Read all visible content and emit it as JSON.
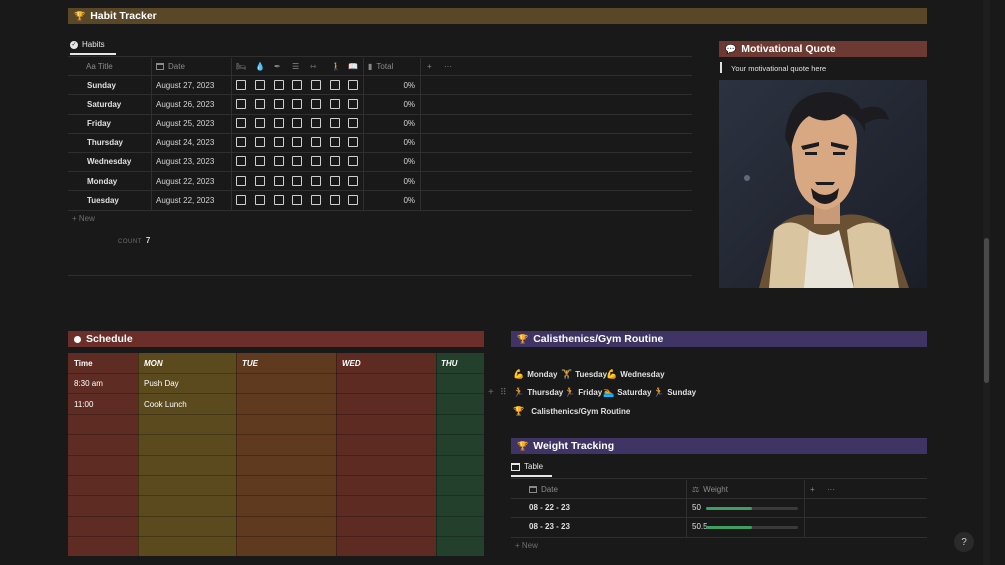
{
  "habit_tracker": {
    "banner_icon": "trophy-icon",
    "title": "Habit Tracker",
    "view_tab": "Habits",
    "columns": {
      "title": "Aa Title",
      "date": "Date",
      "habit_icons": [
        "bed-icon",
        "water-drop-icon",
        "pen-icon",
        "checklist-icon",
        "dumbbell-icon",
        "walking-icon",
        "book-icon"
      ],
      "total": "Total"
    },
    "rows": [
      {
        "title": "Sunday",
        "date": "August 27, 2023",
        "total": "0%"
      },
      {
        "title": "Saturday",
        "date": "August 26, 2023",
        "total": "0%"
      },
      {
        "title": "Friday",
        "date": "August 25, 2023",
        "total": "0%"
      },
      {
        "title": "Thursday",
        "date": "August 24, 2023",
        "total": "0%"
      },
      {
        "title": "Wednesday",
        "date": "August 23, 2023",
        "total": "0%"
      },
      {
        "title": "Monday",
        "date": "August 22, 2023",
        "total": "0%"
      },
      {
        "title": "Tuesday",
        "date": "August 22, 2023",
        "total": "0%"
      }
    ],
    "new_label": "New",
    "count_label": "COUNT",
    "count_value": "7"
  },
  "quote": {
    "title": "Motivational Quote",
    "text": "Your motivational quote here"
  },
  "schedule": {
    "title": "Schedule",
    "headers": [
      "Time",
      "MON",
      "TUE",
      "WED",
      "THU"
    ],
    "rows": [
      {
        "time": "8:30 am",
        "mon": "Push Day"
      },
      {
        "time": "11:00",
        "mon": "Cook Lunch"
      }
    ]
  },
  "calisthenics": {
    "title": "Calisthenics/Gym Routine",
    "days": [
      "Monday",
      "Tuesday",
      "Wednesday",
      "Thursday",
      "Friday",
      "Saturday",
      "Sunday"
    ],
    "link": "Calisthenics/Gym Routine"
  },
  "weight": {
    "title": "Weight Tracking",
    "view_tab": "Table",
    "col_date": "Date",
    "col_weight": "Weight",
    "rows": [
      {
        "date": "08 - 22 - 23",
        "weight": "50",
        "progress": 0.5
      },
      {
        "date": "08 - 23 - 23",
        "weight": "50.5",
        "progress": 0.5
      }
    ],
    "new_label": "New"
  },
  "help_label": "?",
  "colors": {
    "habit_banner": "#5a4728",
    "quote_banner": "#6c3a32",
    "schedule_banner": "#6b2e28",
    "purple_banner": "#3f3464",
    "progress_green": "#3f9e62"
  }
}
